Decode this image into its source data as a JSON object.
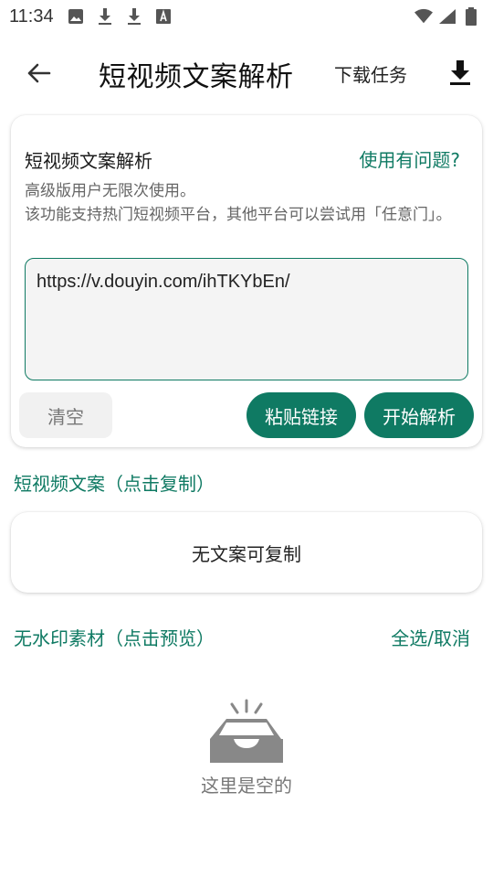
{
  "status_bar": {
    "time": "11:34",
    "left_icons": [
      "image-icon",
      "download-icon",
      "download-icon",
      "font-a-icon"
    ],
    "right_icons": [
      "wifi-icon",
      "signal-icon",
      "battery-icon"
    ]
  },
  "app_bar": {
    "title": "短视频文案解析",
    "tasks_label": "下载任务"
  },
  "parse_card": {
    "title": "短视频文案解析",
    "help_label": "使用有问题?",
    "desc_line1": "高级版用户无限次使用。",
    "desc_line2": "该功能支持热门短视频平台，其他平台可以尝试用「任意门」。",
    "url_value": "https://v.douyin.com/ihTKYbEn/",
    "clear_label": "清空",
    "paste_label": "粘贴链接",
    "parse_label": "开始解析"
  },
  "text_section": {
    "label": "短视频文案（点击复制）",
    "empty_copy": "无文案可复制"
  },
  "media_section": {
    "label": "无水印素材（点击预览）",
    "select_all_label": "全选/取消",
    "empty_text": "这里是空的"
  },
  "colors": {
    "accent": "#0f7a63",
    "muted_text": "#666666",
    "clear_bg": "#f1f1f1"
  }
}
